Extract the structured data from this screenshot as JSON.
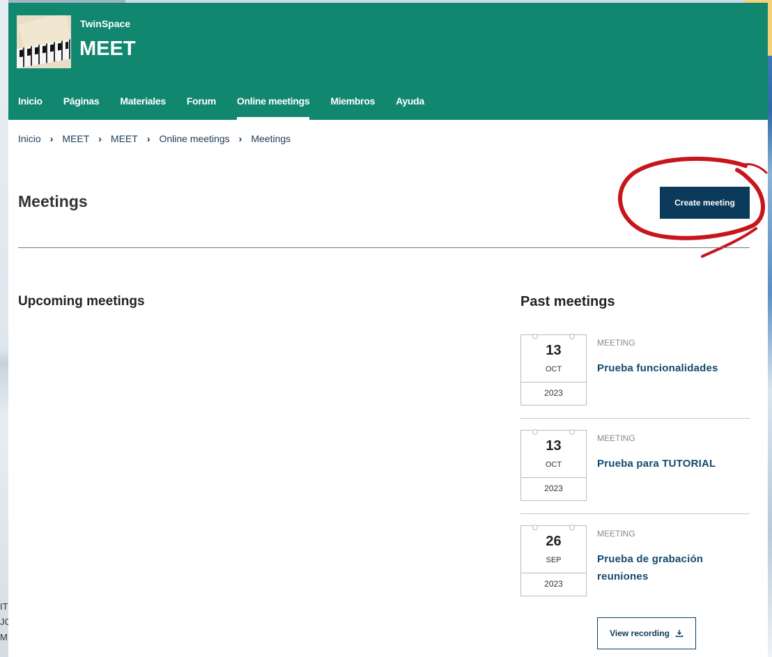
{
  "site": {
    "brand_small": "TwinSpace",
    "brand_big": "MEET"
  },
  "nav": [
    {
      "label": "Inicio",
      "active": false
    },
    {
      "label": "Páginas",
      "active": false
    },
    {
      "label": "Materiales",
      "active": false
    },
    {
      "label": "Forum",
      "active": false
    },
    {
      "label": "Online meetings",
      "active": true
    },
    {
      "label": "Miembros",
      "active": false
    },
    {
      "label": "Ayuda",
      "active": false
    }
  ],
  "breadcrumb": [
    "Inicio",
    "MEET",
    "MEET",
    "Online meetings",
    "Meetings"
  ],
  "page": {
    "title": "Meetings",
    "create_button": "Create meeting"
  },
  "upcoming": {
    "title": "Upcoming meetings"
  },
  "past": {
    "title": "Past meetings",
    "meetings": [
      {
        "day": "13",
        "month": "OCT",
        "year": "2023",
        "type": "MEETING",
        "title": "Prueba funcionalidades"
      },
      {
        "day": "13",
        "month": "OCT",
        "year": "2023",
        "type": "MEETING",
        "title": "Prueba para TUTORIAL"
      },
      {
        "day": "26",
        "month": "SEP",
        "year": "2023",
        "type": "MEETING",
        "title": "Prueba de grabación reuniones"
      }
    ],
    "view_recording": "View recording"
  },
  "colors": {
    "header": "#11876f",
    "button": "#0b3a5a",
    "link": "#124a6e",
    "annotation": "#c8141b"
  },
  "background_fragment": "IT\nJC\nM"
}
